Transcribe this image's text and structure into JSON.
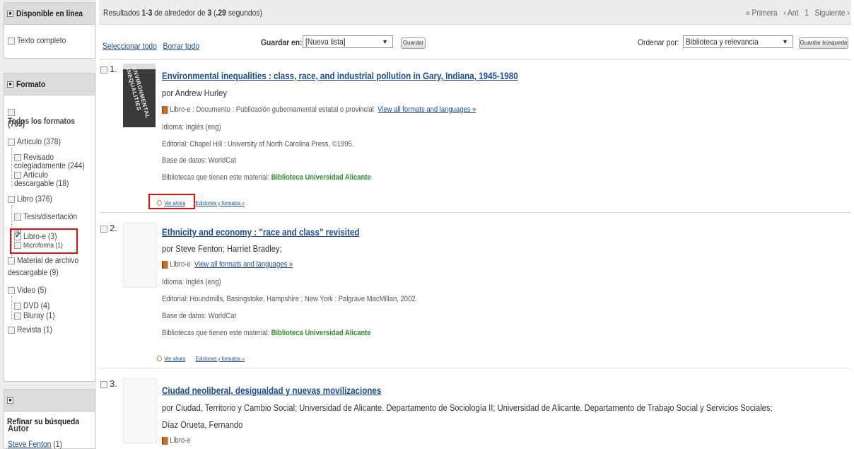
{
  "sidebar": {
    "online": {
      "heading": "Disponible en línea",
      "items": [
        "Texto completo"
      ]
    },
    "format": {
      "heading": "Formato",
      "all_label": "Todos los formatos",
      "all_count": "(769)",
      "articulo": "Artículo (378)",
      "revisado_1": "Revisado",
      "revisado_2": "colegiadamente (244)",
      "desc_1": "Artículo",
      "desc_2": "descargable (18)",
      "libro": "Libro (376)",
      "tesis": "Tesis/disertación",
      "tesis_count": "(4)",
      "libro_e": "Libro-e (3)",
      "microforma": "Microforma (1)",
      "material_1": "Material de archivo",
      "material_2": "descargable (9)",
      "video": "Video (5)",
      "dvd": "DVD (4)",
      "bluray": "Bluray (1)",
      "revista": "Revista (1)"
    },
    "refine": {
      "heading": "Refinar su búsqueda",
      "author_heading": "Autor",
      "author_link": "Steve Fenton",
      "author_count": "(1)"
    }
  },
  "topbar": {
    "results_prefix": "Resultados ",
    "results_range": "1-3",
    "results_mid": " de alrededor de ",
    "results_total": "3",
    "results_time_open": " (",
    "results_time": ".29",
    "results_time_close": " segundos)",
    "first": "« Primera",
    "prev": "‹ Ant",
    "page": "1",
    "next": "Siguiente ›"
  },
  "toolbar": {
    "select_all": "Seleccionar todo",
    "clear_all": "Borrar todo",
    "save_in_label": "Guardar en:",
    "save_in_value": "[Nueva lista]",
    "save_button": "Guardar",
    "sort_label": "Ordenar por:",
    "sort_value": "Biblioteca y relevancia",
    "save_search_button": "Guardar búsqueda"
  },
  "records": [
    {
      "num": "1.",
      "title": "Environmental inequalities : class, race, and industrial pollution in Gary, Indiana, 1945-1980",
      "author": "por Andrew Hurley",
      "format": "Libro-e : Documento : Publicación gubernamental estatal o provincial",
      "formats_link": "View all formats and languages »",
      "language": "Idioma: Inglés (eng)",
      "publisher": "Editorial: Chapel Hill : University of North Carolina Press, ©1995.",
      "database": "Base de datos: WorldCat",
      "libraries_label": "Bibliotecas que tienen este material: ",
      "libraries_value": "Biblioteca Universidad Alicante",
      "view_now": "Ver ahora",
      "editions": "Ediciones y formatos »",
      "cover_text": "ENVIRONMENTAL INEQUALITIES"
    },
    {
      "num": "2.",
      "title": "Ethnicity and economy : \"race and class\" revisited",
      "author": "por Steve Fenton; Harriet Bradley;",
      "format": "Libro-e",
      "formats_link": "View all formats and languages »",
      "language": "Idioma: Inglés (eng)",
      "publisher": "Editorial: Houndmills, Basingstoke, Hampshire ; New York : Palgrave MacMillan, 2002.",
      "database": "Base de datos: WorldCat",
      "libraries_label": "Bibliotecas que tienen este material: ",
      "libraries_value": "Biblioteca Universidad Alicante",
      "view_now": "Ver ahora",
      "editions": "Ediciones y formatos »"
    },
    {
      "num": "3.",
      "title": "Ciudad neoliberal, desigualdad y nuevas movilizaciones",
      "author_1": "por Ciudad, Territorio y Cambio Social; Universidad de Alicante. Departamento de Sociología II; Universidad de Alicante. Departamento de Trabajo Social y Servicios Sociales;",
      "author_2": "Díaz Orueta, Fernando",
      "format": "Libro-e"
    }
  ]
}
